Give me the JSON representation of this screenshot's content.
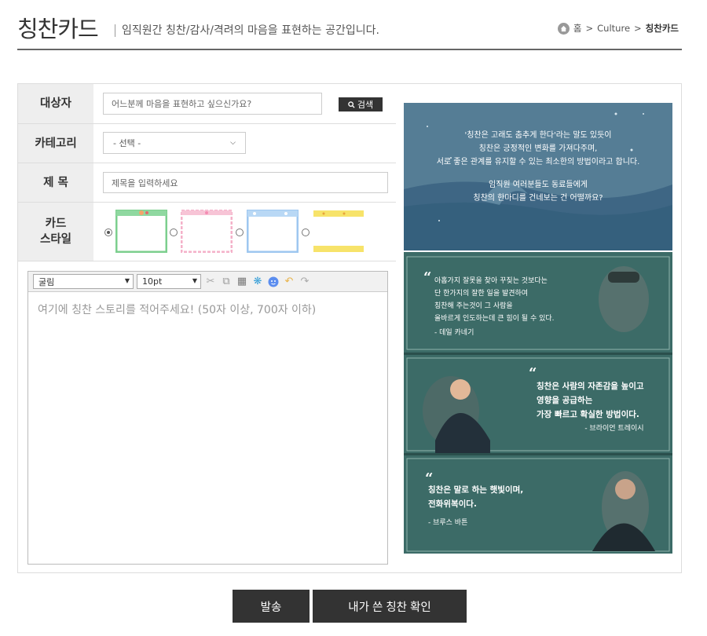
{
  "header": {
    "title": "칭찬카드",
    "subtitle": "임직원간 칭찬/감사/격려의 마음을 표현하는 공간입니다.",
    "breadcrumb": [
      "홈",
      "Culture",
      "칭찬카드"
    ],
    "breadcrumb_separator": ">"
  },
  "form": {
    "target": {
      "label": "대상자",
      "placeholder": "어느분께 마음을 표현하고 싶으신가요?",
      "search_button": "검색"
    },
    "category": {
      "label": "카테고리",
      "selected": "- 선택 -"
    },
    "subject": {
      "label": "제 목",
      "placeholder": "제목을 입력하세요"
    },
    "card_style": {
      "label_line1": "카드",
      "label_line2": "스타일",
      "selected_index": 0,
      "styles": [
        "green-frame",
        "pink-frame",
        "blue-frame",
        "yellow-frame"
      ]
    }
  },
  "editor": {
    "font": "굴림",
    "size": "10pt",
    "placeholder": "여기에 칭찬 스토리를 적어주세요! (50자 이상, 700자 이하)",
    "tools": [
      "cut-icon",
      "copy-icon",
      "paste-icon",
      "special-char-icon",
      "emoticon-icon",
      "undo-icon",
      "redo-icon"
    ]
  },
  "promo": {
    "intro_lines": [
      "'칭찬은 고래도 춤추게 한다'라는 말도 있듯이",
      "칭찬은 긍정적인 변화를 가져다주며,",
      "서로 좋은 관계를 유지할 수 있는 최소한의 방법이라고 합니다.",
      "임직원 여러분들도 동료들에게",
      "칭찬의 한마디를 건네보는 건 어떨까요?"
    ],
    "quote1_lines": [
      "아홉가지 잘못을 찾아 꾸짖는 것보다는",
      "단 한가지의 잘한 일을 발견하여",
      "칭찬해 주는것이 그 사람을",
      "올바르게 인도하는데 큰 힘이 될 수 있다."
    ],
    "quote1_author": "- 데일 카네기",
    "quote2_lines": [
      "칭찬은 사람의 자존감을 높이고",
      "영향을 공급하는",
      "가장 빠르고 확실한 방법이다."
    ],
    "quote2_author": "- 브라이언 트레이시",
    "quote3_lines": [
      "칭찬은 말로 하는 햇빛이며,",
      "전화위복이다."
    ],
    "quote3_author": "- 브루스 바튼"
  },
  "actions": {
    "send": "발송",
    "my_praise": "내가 쓴 칭찬 확인"
  },
  "colors": {
    "dark": "#333333",
    "teal": "#3e6e6c",
    "sea": "#5c8ca8"
  }
}
